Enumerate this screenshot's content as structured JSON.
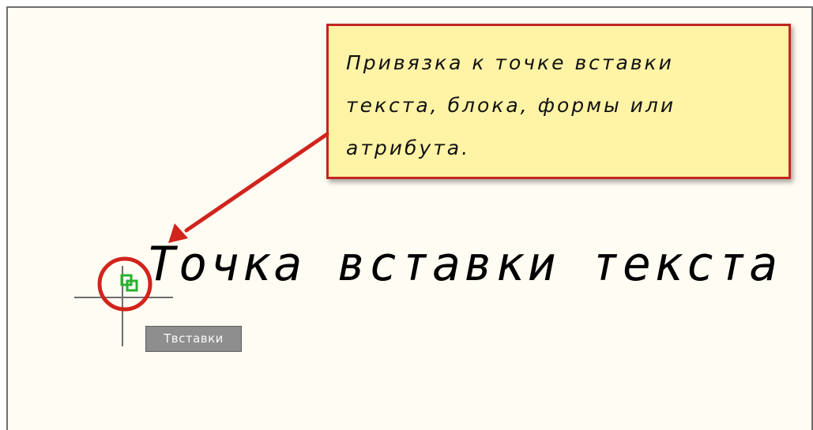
{
  "callout": {
    "text": "Привязка к точке вставки\nтекста, блока, формы или\nатрибута."
  },
  "drawing": {
    "text": "Точка вставки текста"
  },
  "snap": {
    "tooltip": "Твставки",
    "marker_icon": "insertion-snap-icon",
    "crosshair_icon": "crosshair-cursor-icon"
  },
  "annotations": {
    "arrow_icon": "pointer-arrow-icon",
    "circle_icon": "highlight-circle-icon"
  },
  "colors": {
    "canvas_background": "#fffdf3",
    "callout_background": "#fff3a6",
    "annotation_red": "#d0241c",
    "snap_green": "#27b12c",
    "tooltip_background": "#8e8e8e"
  }
}
